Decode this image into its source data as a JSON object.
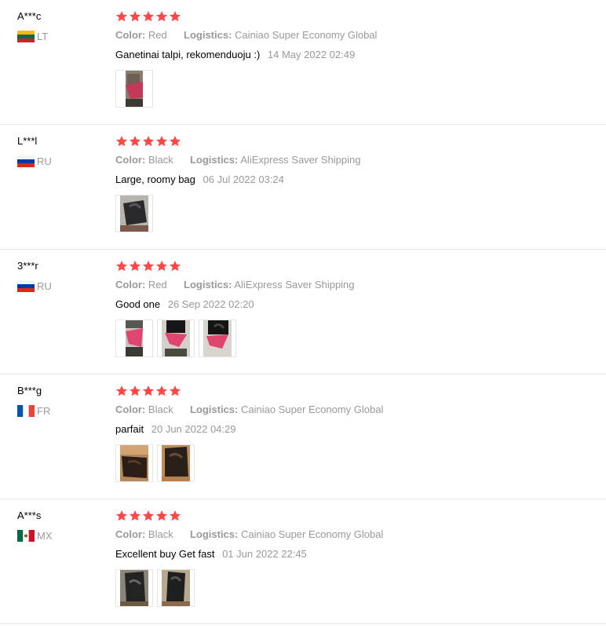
{
  "labels": {
    "color_key": "Color:",
    "logistics_key": "Logistics:"
  },
  "colors": {
    "star": "#ff4747",
    "meta_grey": "#999999"
  },
  "reviews": [
    {
      "user": "A***c",
      "country": "LT",
      "flag_icon": "lithuania-flag-icon",
      "stars": 5,
      "color": "Red",
      "logistics": "Cainiao Super Economy Global",
      "text": "Ganetinai talpi, rekomenduoju :)",
      "date": "14 May 2022 02:49",
      "photos": [
        "red-bag-photo"
      ]
    },
    {
      "user": "L***l",
      "country": "RU",
      "flag_icon": "russia-flag-icon",
      "stars": 5,
      "color": "Black",
      "logistics": "AliExpress Saver Shipping",
      "text": "Large, roomy bag",
      "date": "06 Jul 2022 03:24",
      "photos": [
        "black-bag-photo"
      ]
    },
    {
      "user": "3***r",
      "country": "RU",
      "flag_icon": "russia-flag-icon",
      "stars": 5,
      "color": "Red",
      "logistics": "AliExpress Saver Shipping",
      "text": "Good one",
      "date": "26 Sep 2022 02:20",
      "photos": [
        "red-bag-photo",
        "red-bag-photo",
        "red-bag-photo"
      ]
    },
    {
      "user": "B***g",
      "country": "FR",
      "flag_icon": "france-flag-icon",
      "stars": 5,
      "color": "Black",
      "logistics": "Cainiao Super Economy Global",
      "text": "parfait",
      "date": "20 Jun 2022 04:29",
      "photos": [
        "black-bag-photo",
        "black-bag-photo"
      ]
    },
    {
      "user": "A***s",
      "country": "MX",
      "flag_icon": "mexico-flag-icon",
      "stars": 5,
      "color": "Black",
      "logistics": "Cainiao Super Economy Global",
      "text": "Excellent buy Get fast",
      "date": "01 Jun 2022 22:45",
      "photos": [
        "black-bag-photo",
        "black-bag-photo"
      ]
    }
  ]
}
